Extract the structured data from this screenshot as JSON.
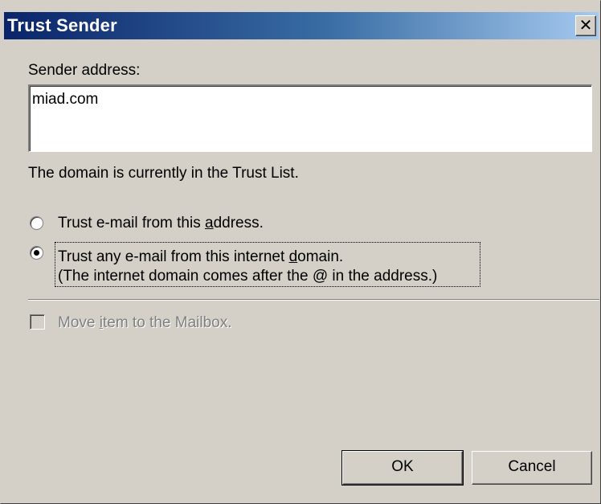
{
  "window": {
    "title": "Trust Sender",
    "close_glyph": "✕",
    "colors": {
      "titlebar_start": "#0a246a",
      "titlebar_end": "#a6caf0",
      "face": "#d4d0c8"
    }
  },
  "sender": {
    "label": "Sender address:",
    "value": "miad.com"
  },
  "status_text": "The domain is currently in the Trust List.",
  "options": {
    "trust_address": {
      "label_before": "Trust e-mail from this ",
      "label_accel": "a",
      "label_after": "ddress.",
      "selected": false
    },
    "trust_domain": {
      "label_before": "Trust any e-mail from this internet ",
      "label_accel": "d",
      "label_after": "omain.",
      "label_line2": "(The internet domain comes after the @ in the address.)",
      "selected": true
    }
  },
  "move_item": {
    "label_before": "Move ",
    "label_accel": "i",
    "label_after": "tem to the Mailbox.",
    "checked": false,
    "enabled": false
  },
  "buttons": {
    "ok": "OK",
    "cancel": "Cancel"
  }
}
